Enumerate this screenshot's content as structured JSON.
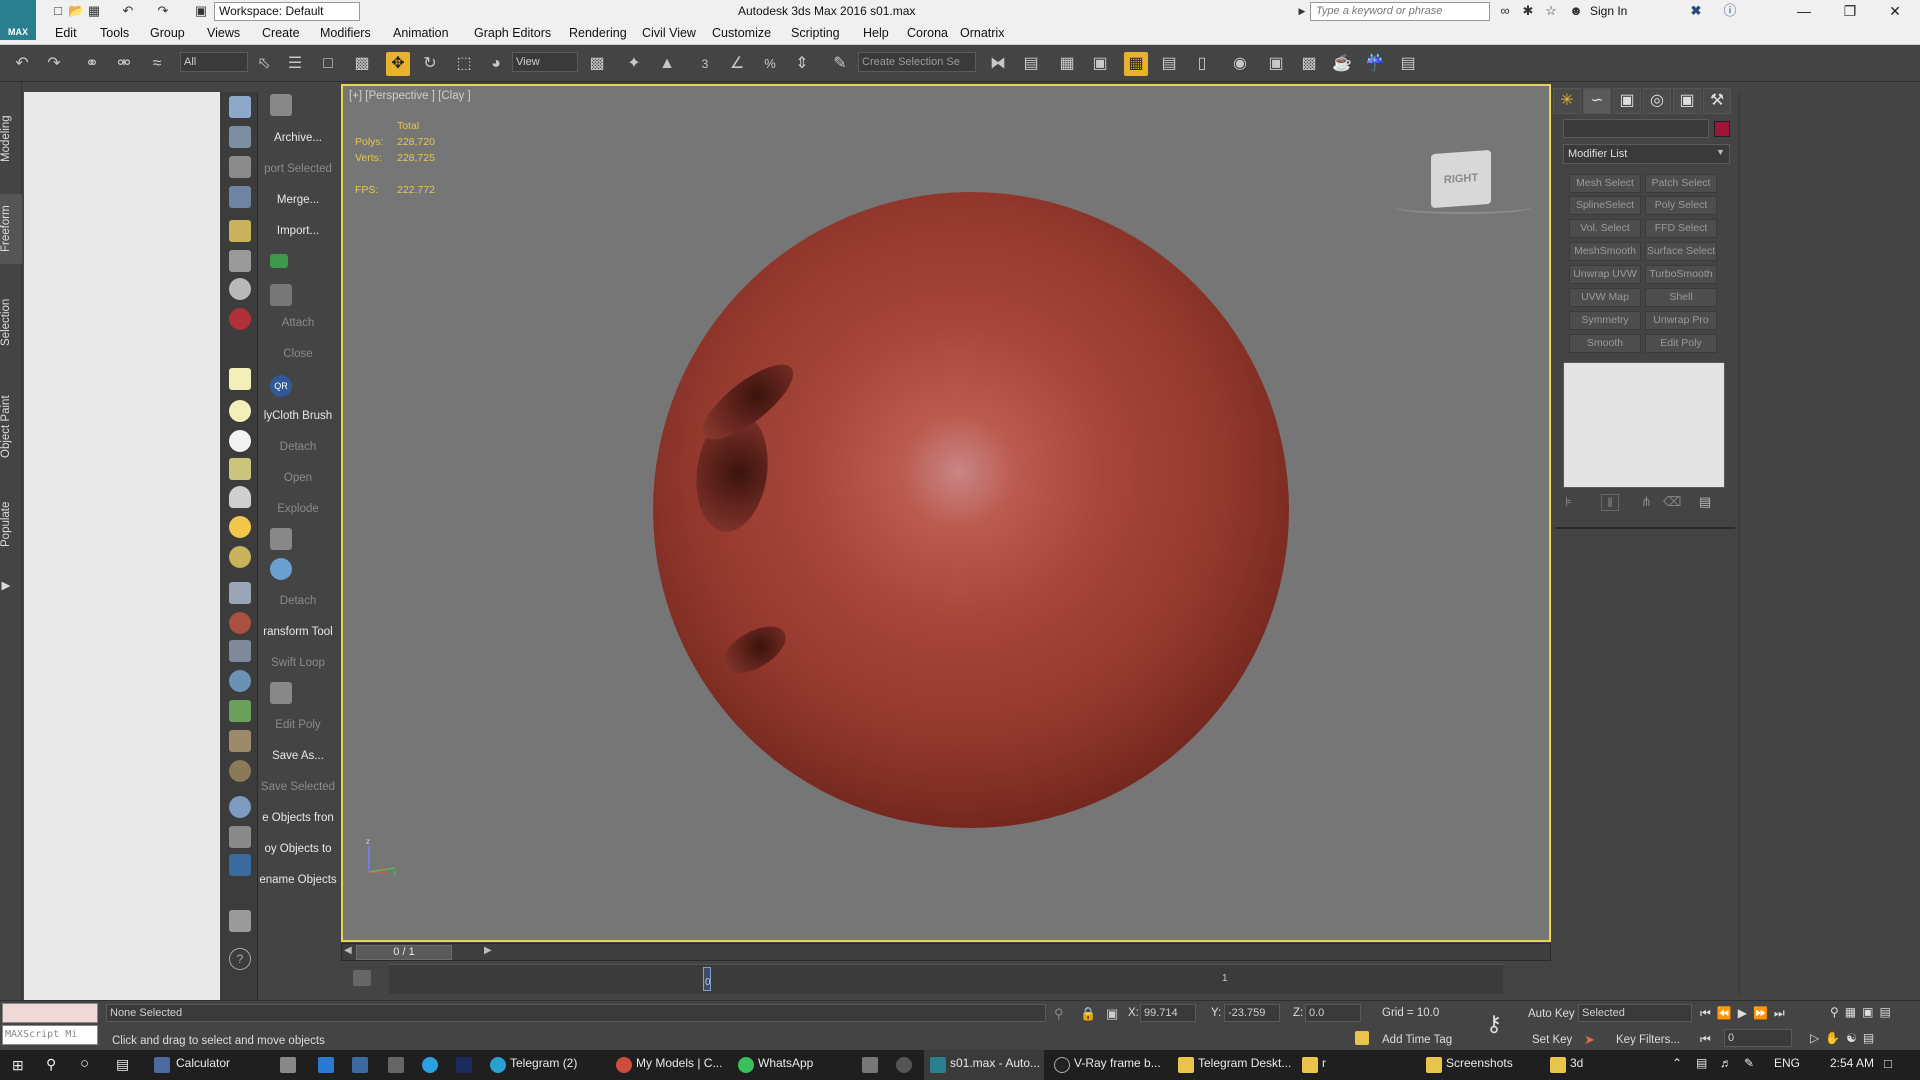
{
  "titlebar": {
    "logo": "MAX",
    "workspace": "Workspace: Default",
    "title": "Autodesk 3ds Max 2016      s01.max",
    "search_placeholder": "Type a keyword or phrase",
    "signin": "Sign In"
  },
  "menu": [
    "Edit",
    "Tools",
    "Group",
    "Views",
    "Create",
    "Modifiers",
    "Animation",
    "Graph Editors",
    "Rendering",
    "Civil View",
    "Customize",
    "Scripting",
    "Help",
    "Corona",
    "Ornatrix"
  ],
  "toolbar": {
    "filter": "All",
    "refcoord": "View",
    "selection_set_placeholder": "Create Selection Se",
    "snaps": [
      "3",
      "%"
    ]
  },
  "ribbon_tabs": [
    "Modeling",
    "Freeform",
    "Selection",
    "Object Paint",
    "Populate"
  ],
  "commands": [
    {
      "label": "Archive...",
      "state": "on"
    },
    {
      "label": "port Selected",
      "state": "off"
    },
    {
      "label": "Merge...",
      "state": "on"
    },
    {
      "label": "Import...",
      "state": "on"
    },
    {
      "label": "Attach",
      "state": "off"
    },
    {
      "label": "Close",
      "state": "off"
    },
    {
      "label": "lyCloth Brush",
      "state": "on"
    },
    {
      "label": "Detach",
      "state": "off"
    },
    {
      "label": "Open",
      "state": "off"
    },
    {
      "label": "Explode",
      "state": "off"
    },
    {
      "label": "Detach",
      "state": "off"
    },
    {
      "label": "ransform Tool",
      "state": "on"
    },
    {
      "label": "Swift Loop",
      "state": "off"
    },
    {
      "label": "Edit Poly",
      "state": "off"
    },
    {
      "label": "Save As...",
      "state": "on"
    },
    {
      "label": "Save Selected",
      "state": "off"
    },
    {
      "label": "e Objects fron",
      "state": "on"
    },
    {
      "label": "oy Objects to",
      "state": "on"
    },
    {
      "label": "ename Objects",
      "state": "on"
    }
  ],
  "viewport": {
    "label": "[+] [Perspective ] [Clay ]",
    "stats": {
      "total_label": "Total",
      "polys_label": "Polys:",
      "polys": "228,720",
      "verts_label": "Verts:",
      "verts": "228,725",
      "fps_label": "FPS:",
      "fps": "222.772"
    },
    "viewcube": "RIGHT",
    "axis": {
      "z": "z",
      "x": "x",
      "y": "y"
    },
    "object_color": "#a8463a"
  },
  "timeline": {
    "frame": "0 / 1",
    "tick_label": "1",
    "start_tick": "0"
  },
  "command_panel": {
    "color_swatch": "#a0163a",
    "modifier_list": "Modifier List",
    "modifier_buttons": [
      [
        "Mesh Select",
        "Patch Select"
      ],
      [
        "SplineSelect",
        "Poly Select"
      ],
      [
        "Vol. Select",
        "FFD Select"
      ],
      [
        "MeshSmooth",
        "Surface Select"
      ],
      [
        "Unwrap UVW",
        "TurboSmooth"
      ],
      [
        "UVW Map",
        "Shell"
      ],
      [
        "Symmetry",
        "Unwrap Pro"
      ],
      [
        "Smooth",
        "Edit Poly"
      ]
    ]
  },
  "status": {
    "maxscript": "MAXScript Mi",
    "selection": "None Selected",
    "prompt": "Click and drag to select and move objects",
    "x_label": "X:",
    "x": "99.714",
    "y_label": "Y:",
    "y": "-23.759",
    "z_label": "Z:",
    "z": "0.0",
    "grid": "Grid = 10.0",
    "add_time_tag": "Add Time Tag",
    "auto_key": "Auto Key",
    "set_key": "Set Key",
    "key_mode": "Selected",
    "key_filters": "Key Filters...",
    "current_frame": "0"
  },
  "taskbar": {
    "items": [
      "Calculator",
      "Telegram (2)",
      "My Models | C...",
      "WhatsApp",
      "s01.max - Auto...",
      "V-Ray frame b...",
      "Telegram Deskt...",
      "r",
      "Screenshots",
      "3d"
    ],
    "lang": "ENG",
    "time": "2:54 AM"
  }
}
